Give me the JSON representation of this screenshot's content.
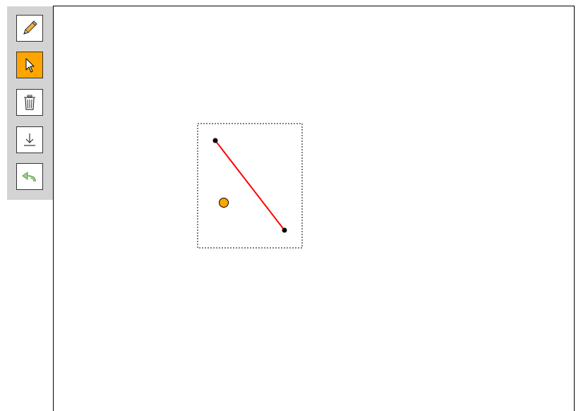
{
  "toolbar": {
    "tools": [
      {
        "name": "pencil-tool",
        "icon": "pencil-icon",
        "active": false
      },
      {
        "name": "select-tool",
        "icon": "cursor-arrow-icon",
        "active": true
      },
      {
        "name": "delete-tool",
        "icon": "trash-icon",
        "active": false
      },
      {
        "name": "download-tool",
        "icon": "download-icon",
        "active": false
      },
      {
        "name": "undo-tool",
        "icon": "undo-icon",
        "active": false
      }
    ],
    "active_color": "#ffa500",
    "background_color": "#d3d3d3"
  },
  "canvas": {
    "line_color": "#ff0000",
    "endpoint_color": "#000000",
    "handle_color": "#ffa500",
    "selection_style": "dotted"
  }
}
